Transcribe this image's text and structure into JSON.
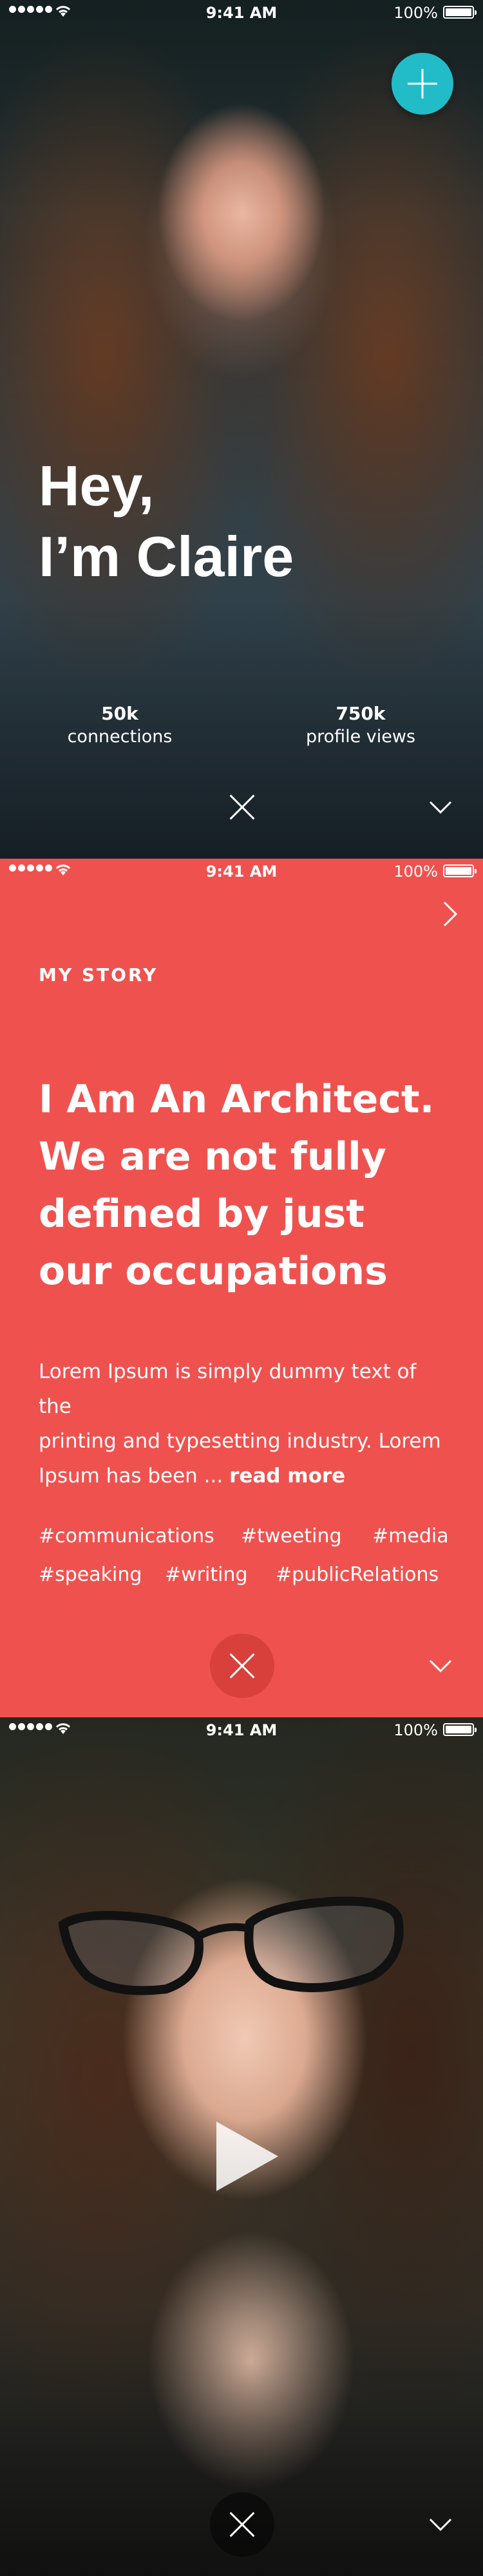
{
  "status_bar": {
    "time": "9:41 AM",
    "battery": "100%",
    "icons": [
      "signal-dots-icon",
      "wifi-icon",
      "battery-icon"
    ]
  },
  "profile": {
    "greeting_line1": "Hey,",
    "greeting_line2": "I’m Claire",
    "stats": [
      {
        "value": "50k",
        "label": "connections"
      },
      {
        "value": "750k",
        "label": "profile views"
      }
    ],
    "actions": [
      "add-icon",
      "close-icon",
      "chevron-down-icon"
    ],
    "accent_color": "#22bcc9"
  },
  "story": {
    "eyebrow": "MY STORY",
    "headline": [
      "I Am An Architect.",
      "We are not fully",
      "defined by just",
      "our occupations"
    ],
    "body_lines": [
      "Lorem Ipsum is simply dummy text of the",
      "printing and typesetting industry. Lorem",
      "Ipsum has been ... "
    ],
    "read_more": "read more",
    "tags": [
      "#communications",
      "#tweeting",
      "#media",
      "#speaking",
      "#writing",
      "#publicRelations"
    ],
    "background_color": "#ef524e",
    "actions": [
      "chevron-right-icon",
      "close-icon",
      "chevron-down-icon"
    ]
  },
  "video": {
    "actions": [
      "play-icon",
      "close-icon",
      "chevron-down-icon"
    ]
  }
}
